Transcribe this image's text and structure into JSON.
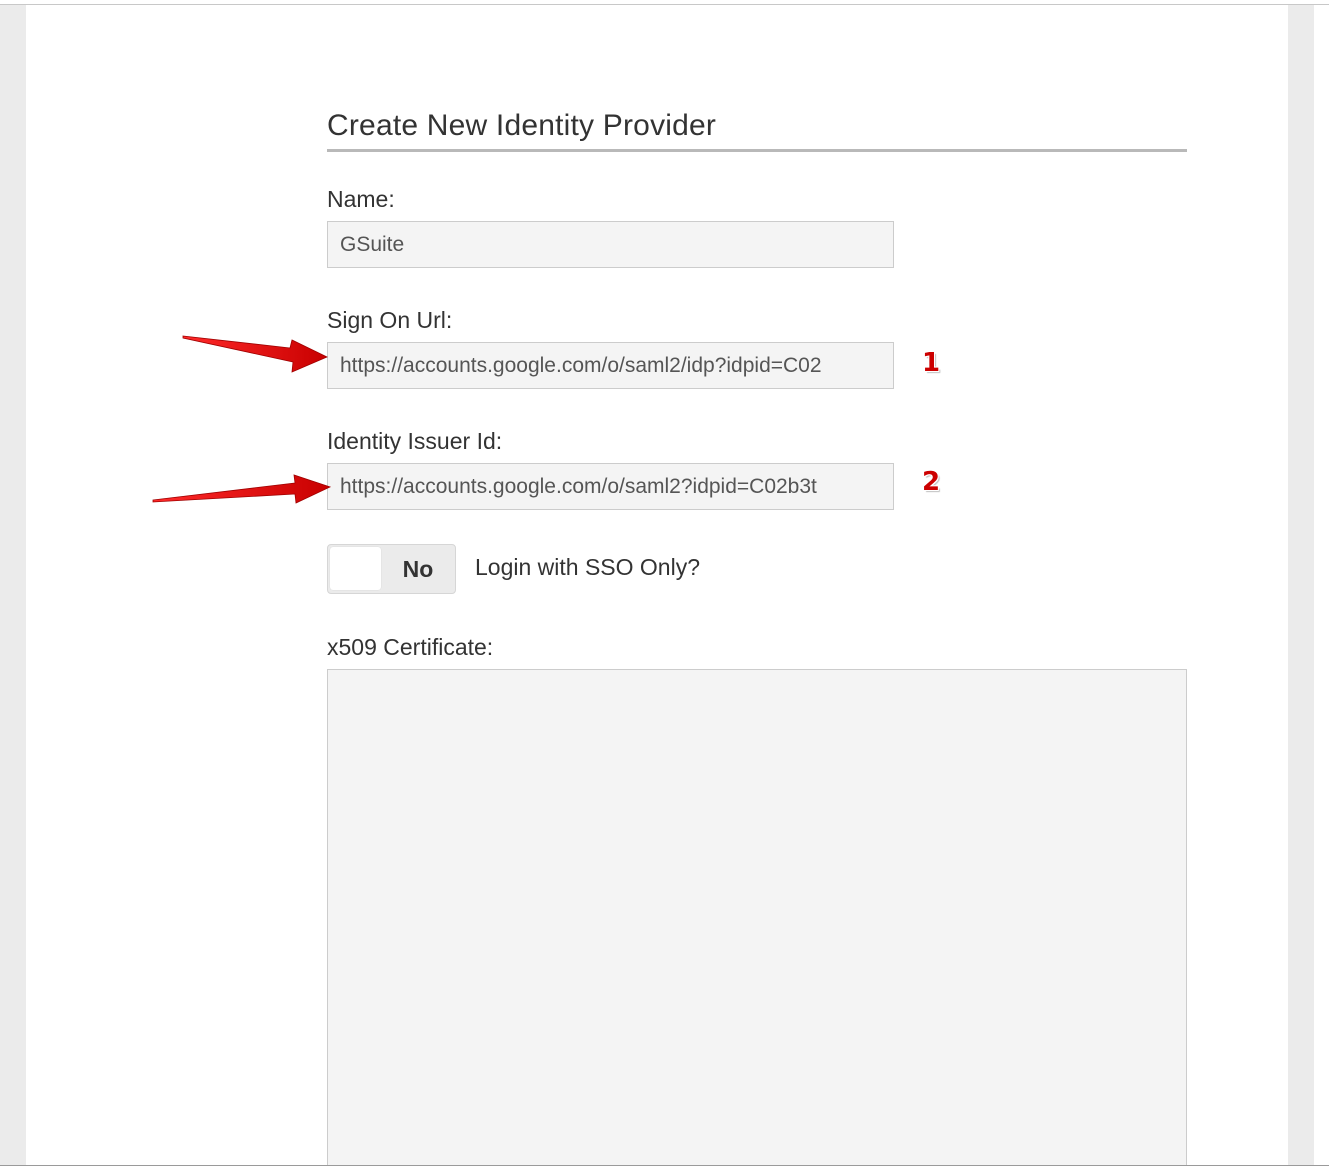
{
  "form": {
    "title": "Create New Identity Provider",
    "name": {
      "label": "Name:",
      "value": "GSuite"
    },
    "sign_on_url": {
      "label": "Sign On Url:",
      "value": "https://accounts.google.com/o/saml2/idp?idpid=C02"
    },
    "identity_issuer_id": {
      "label": "Identity Issuer Id:",
      "value": "https://accounts.google.com/o/saml2?idpid=C02b3t"
    },
    "sso_only": {
      "toggle_state": "No",
      "label": "Login with SSO Only?"
    },
    "certificate": {
      "label": "x509 Certificate:",
      "value": ""
    }
  },
  "annotations": {
    "marker_1": "1",
    "marker_2": "2",
    "arrow_color": "#dd0000"
  }
}
